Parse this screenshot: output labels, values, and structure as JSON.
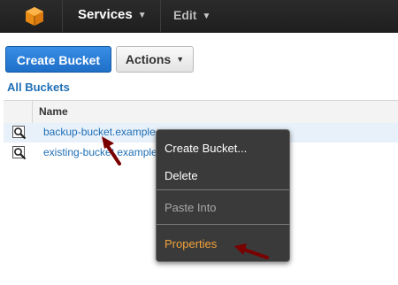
{
  "topnav": {
    "services": "Services",
    "edit": "Edit"
  },
  "toolbar": {
    "create_bucket": "Create Bucket",
    "actions": "Actions"
  },
  "section": {
    "heading": "All Buckets"
  },
  "table": {
    "columns": [
      "Name"
    ],
    "rows": [
      {
        "name": "backup-bucket.example",
        "selected": true
      },
      {
        "name": "existing-bucket.example",
        "selected": false
      }
    ]
  },
  "context_menu": {
    "items": [
      {
        "label": "Create Bucket...",
        "state": "normal"
      },
      {
        "label": "Delete",
        "state": "normal"
      },
      {
        "label": "Paste Into",
        "state": "disabled"
      },
      {
        "label": "Properties",
        "state": "highlighted"
      }
    ]
  },
  "colors": {
    "accent_blue": "#1f6fb5",
    "logo_orange": "#f7981d",
    "menu_highlight": "#f2a33a",
    "annotation_arrow": "#7a0000"
  },
  "icons": [
    "aws-cube-logo",
    "magnifier-icon",
    "chevron-down-icon",
    "annotation-arrow"
  ]
}
